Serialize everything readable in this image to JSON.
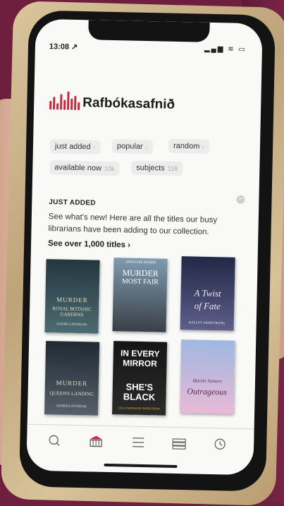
{
  "status": {
    "time": "13:08 ↗",
    "icons": "▂▄▆ ≋ ▭"
  },
  "app": {
    "name": "Rafbókasafnið"
  },
  "chips": [
    {
      "label": "just added",
      "count": ""
    },
    {
      "label": "popular",
      "count": ""
    },
    {
      "label": "random",
      "count": ""
    },
    {
      "label": "available now",
      "count": "10k"
    },
    {
      "label": "subjects",
      "count": "118"
    }
  ],
  "section": {
    "title": "JUST ADDED",
    "description": "See what's new! Here are all the titles our busy librarians have been adding to our collection.",
    "see_all": "See over 1,000 titles ›"
  },
  "books": [
    {
      "line1": "MURDER",
      "line2": "ROYAL BOTANIC GARDENS",
      "author": "ANDREA PENROSE",
      "colors": [
        "#24373f",
        "#4c6b72"
      ]
    },
    {
      "line1": "MURDER",
      "line2": "MOST FAIR",
      "author": "ANNA LEE HUBER",
      "colors": [
        "#7e9bb0",
        "#3a3f47"
      ]
    },
    {
      "line1": "A Twist",
      "line2": "of Fate",
      "author": "KELLEY ARMSTRONG",
      "colors": [
        "#232846",
        "#5d5f8a"
      ]
    },
    {
      "line1": "MURDER",
      "line2": "QUEEN'S LANDING",
      "author": "ANDREA PENROSE",
      "colors": [
        "#1f2a33",
        "#55606a"
      ]
    },
    {
      "line1": "IN EVERY MIRROR",
      "line2": "SHE'S BLACK",
      "author": "LOLA AKINMADE ÅKERSTRÖM",
      "colors": [
        "#151515",
        "#2b2b2b"
      ]
    },
    {
      "line1": "Martin Somers",
      "line2": "Outrageous",
      "author": "",
      "colors": [
        "#9fb8e0",
        "#e9b9d6"
      ]
    }
  ],
  "tabs": [
    {
      "name": "search-icon"
    },
    {
      "name": "library-icon"
    },
    {
      "name": "list-icon"
    },
    {
      "name": "books-icon"
    },
    {
      "name": "clock-icon"
    }
  ],
  "accent_color": "#c8283a"
}
